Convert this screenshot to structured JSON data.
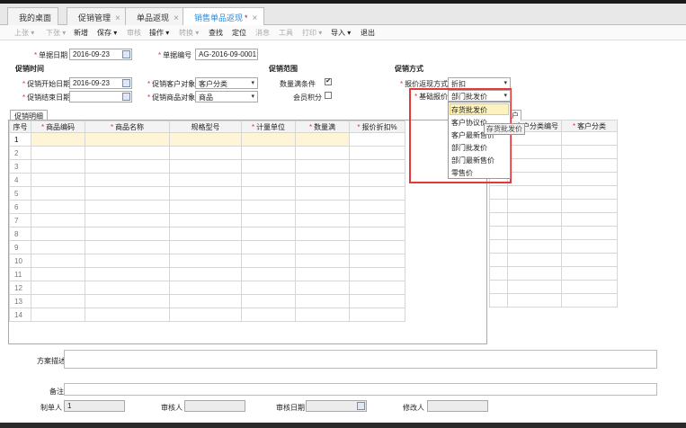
{
  "tabs": [
    {
      "label": "我的桌面",
      "close": ""
    },
    {
      "label": "促销管理",
      "close": "×"
    },
    {
      "label": "单品返现",
      "close": "×"
    },
    {
      "label": "销售单品返现",
      "close": "×",
      "modified": "*"
    }
  ],
  "toolbar": {
    "items": [
      {
        "label": "上张 ▾",
        "disabled": true
      },
      {
        "label": "下张 ▾",
        "disabled": true
      },
      {
        "label": "新增",
        "disabled": false
      },
      {
        "label": "保存 ▾",
        "disabled": false
      },
      {
        "label": "审核",
        "disabled": true
      },
      {
        "label": "操作 ▾",
        "disabled": false
      },
      {
        "label": "转换 ▾",
        "disabled": true
      },
      {
        "label": "查找",
        "disabled": false
      },
      {
        "label": "定位",
        "disabled": false
      },
      {
        "label": "消息",
        "disabled": true
      },
      {
        "label": "工具",
        "disabled": true
      },
      {
        "label": "打印 ▾",
        "disabled": true
      },
      {
        "label": "导入 ▾",
        "disabled": false
      },
      {
        "label": "退出",
        "disabled": false
      }
    ]
  },
  "form": {
    "bill_date_label": "单据日期",
    "bill_date": "2016-09-23",
    "bill_no_label": "单据编号",
    "bill_no": "AG-2016-09-0001",
    "section_time": "促销时间",
    "section_scope": "促销范围",
    "section_method": "促销方式",
    "start_label": "促销开始日期",
    "start_date": "2016-09-23",
    "end_label": "促销结束日期",
    "end_date": "",
    "customer_obj_label": "促销客户对象",
    "customer_obj": "客户分类",
    "product_obj_label": "促销商品对象",
    "product_obj": "商品",
    "qty_condition_label": "数量满条件",
    "qty_condition_checked": "✔",
    "points_label": "会员积分",
    "rebate_method_label": "报价返现方式",
    "rebate_method": "折扣",
    "base_price_label": "基础报价",
    "base_price": "部门批发价"
  },
  "dropdown": {
    "options": [
      "存货批发价",
      "客户协议价",
      "客户最新售价",
      "部门批发价",
      "部门最新售价",
      "零售价"
    ],
    "tooltip": "存货批发价"
  },
  "detail": {
    "tab_label": "促销明细",
    "columns": [
      "序号",
      "商品编码",
      "商品名称",
      "规格型号",
      "计量单位",
      "数量满",
      "报价折扣%"
    ],
    "required_cols": [
      false,
      true,
      true,
      false,
      true,
      true,
      true
    ],
    "rows": [
      "1",
      "2",
      "3",
      "4",
      "5",
      "6",
      "7",
      "8",
      "9",
      "10",
      "11",
      "12",
      "13",
      "14"
    ]
  },
  "right_grid": {
    "tab_fragment": "户",
    "columns": [
      "客户分类编号",
      "客户分类"
    ]
  },
  "footer": {
    "desc_label": "方案描述",
    "remark_label": "备注",
    "maker_label": "制单人",
    "maker": "1",
    "auditor_label": "审核人",
    "audit_date_label": "审核日期",
    "modifier_label": "修改人"
  }
}
